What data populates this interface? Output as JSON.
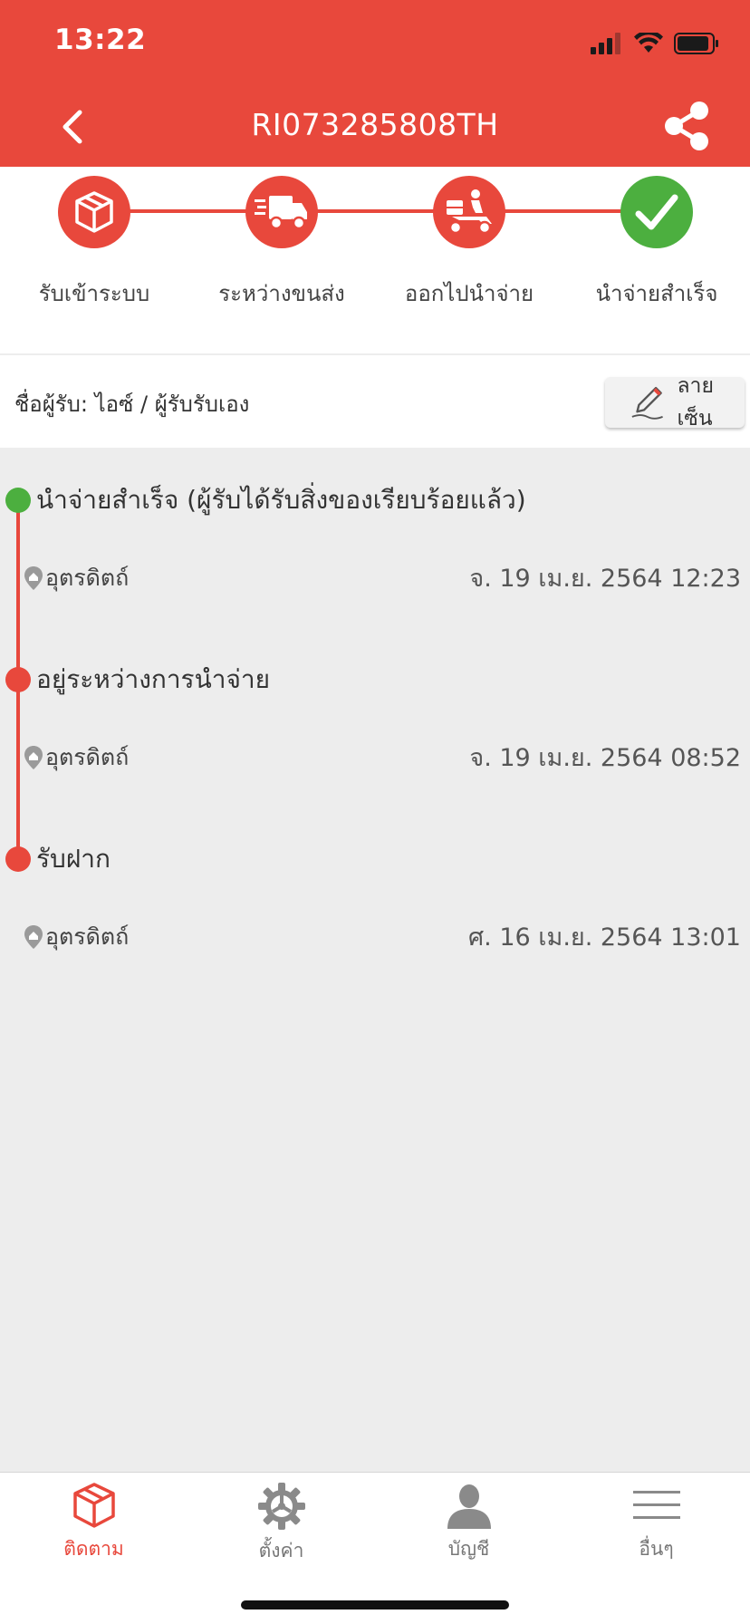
{
  "status_bar": {
    "time": "13:22"
  },
  "header": {
    "title": "RI073285808TH"
  },
  "steps": [
    {
      "label": "รับเข้าระบบ",
      "icon": "package-icon",
      "done": false
    },
    {
      "label": "ระหว่างขนส่ง",
      "icon": "truck-icon",
      "done": false
    },
    {
      "label": "ออกไปนำจ่าย",
      "icon": "courier-scooter-icon",
      "done": false
    },
    {
      "label": "นำจ่ายสำเร็จ",
      "icon": "checkmark-icon",
      "done": true
    }
  ],
  "recipient": {
    "text": "ชื่อผู้รับ: ไอซ์ / ผู้รับรับเอง",
    "signature_label": "ลายเซ็น"
  },
  "timeline": [
    {
      "title": "นำจ่ายสำเร็จ (ผู้รับได้รับสิ่งของเรียบร้อยแล้ว)",
      "location": "อุตรดิตถ์",
      "time": "จ. 19 เม.ย. 2564 12:23",
      "status": "delivered"
    },
    {
      "title": "อยู่ระหว่างการนำจ่าย",
      "location": "อุตรดิตถ์",
      "time": "จ. 19 เม.ย. 2564 08:52",
      "status": "in-progress"
    },
    {
      "title": "รับฝาก",
      "location": "อุตรดิตถ์",
      "time": "ศ. 16 เม.ย. 2564 13:01",
      "status": "in-progress"
    }
  ],
  "tabs": [
    {
      "label": "ติดตาม",
      "icon": "package-icon",
      "active": true
    },
    {
      "label": "ตั้งค่า",
      "icon": "gear-icon",
      "active": false
    },
    {
      "label": "บัญชี",
      "icon": "person-icon",
      "active": false
    },
    {
      "label": "อื่นๆ",
      "icon": "menu-icon",
      "active": false
    }
  ],
  "colors": {
    "brand_red": "#e8483c",
    "success_green": "#4caf3f",
    "background": "#ededed"
  }
}
